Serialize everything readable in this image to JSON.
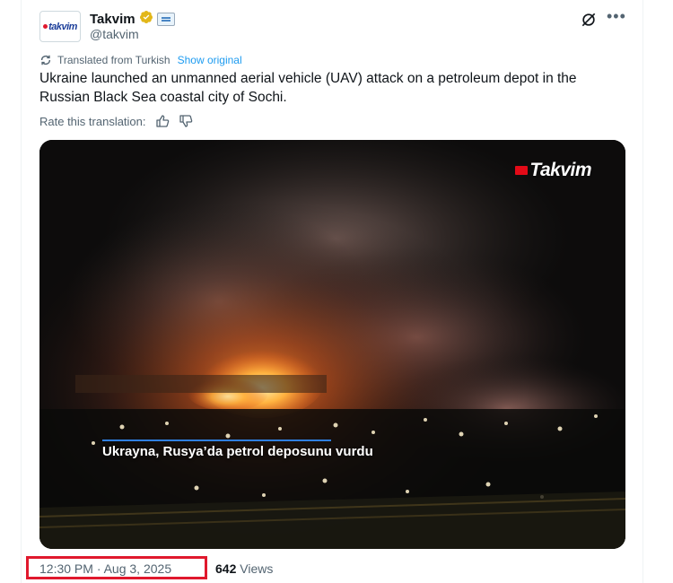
{
  "author": {
    "display_name": "Takvim",
    "handle": "@takvim",
    "avatar_logo_text": "takvim"
  },
  "translation": {
    "label": "Translated from Turkish",
    "show_original": "Show original",
    "rate_label": "Rate this translation:"
  },
  "tweet": {
    "text": "Ukraine launched an unmanned aerial vehicle (UAV) attack on a petroleum depot in the Russian Black Sea coastal city of Sochi."
  },
  "media": {
    "watermark": "Takvim",
    "subtitle": "Ukrayna, Rusya’da petrol deposunu vurdu"
  },
  "footer": {
    "timestamp": "12:30 PM · Aug 3, 2025",
    "views_count": "642",
    "views_label": "Views"
  },
  "icons": {
    "verified": "verified-gold-icon",
    "affiliate": "affiliate-badge-icon",
    "grok": "grok-icon",
    "more": "more-icon",
    "translate": "translate-icon",
    "thumbs_up": "thumbs-up-icon",
    "thumbs_down": "thumbs-down-icon"
  },
  "colors": {
    "link": "#1d9bf0",
    "text": "#0f1419",
    "secondary": "#536471",
    "verified_gold": "#e2b719",
    "highlight_box": "#e0182d"
  }
}
